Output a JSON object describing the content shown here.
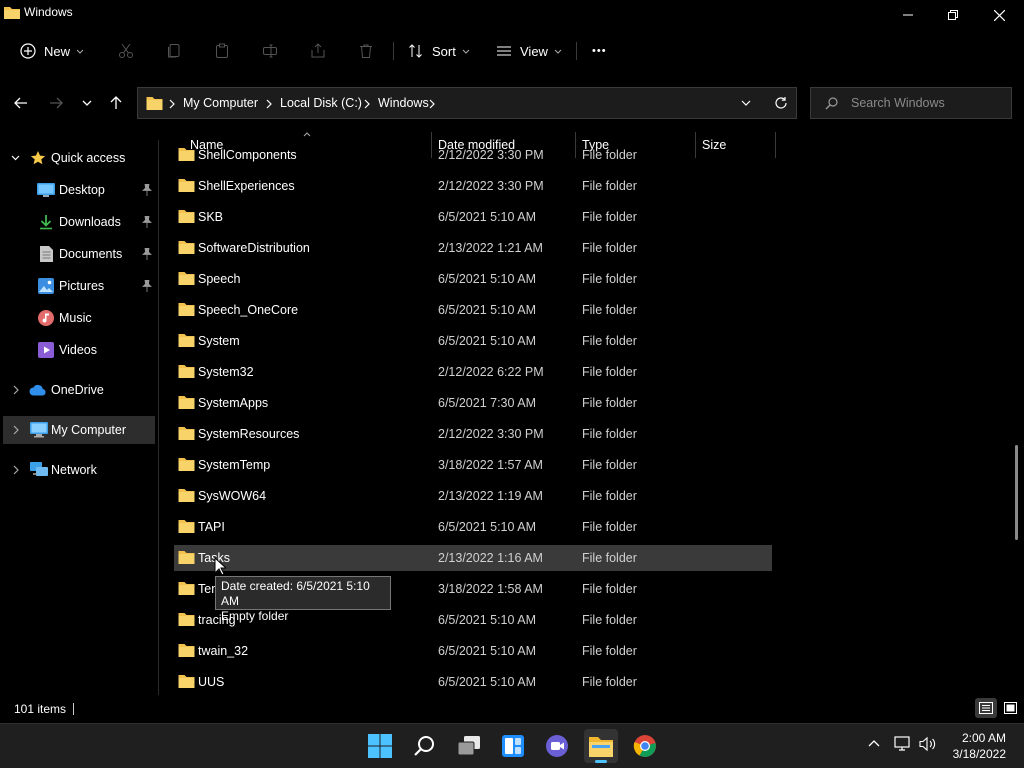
{
  "window": {
    "title": "Windows"
  },
  "toolbar": {
    "new_label": "New",
    "sort_label": "Sort",
    "view_label": "View",
    "more_label": "•••"
  },
  "address": {
    "segments": [
      "My Computer",
      "Local Disk (C:)",
      "Windows"
    ]
  },
  "search": {
    "placeholder": "Search Windows"
  },
  "sidebar": {
    "quick_access": "Quick access",
    "items": [
      {
        "label": "Desktop"
      },
      {
        "label": "Downloads"
      },
      {
        "label": "Documents"
      },
      {
        "label": "Pictures"
      },
      {
        "label": "Music"
      },
      {
        "label": "Videos"
      }
    ],
    "onedrive": "OneDrive",
    "my_computer": "My Computer",
    "network": "Network"
  },
  "columns": {
    "name": "Name",
    "date": "Date modified",
    "type": "Type",
    "size": "Size"
  },
  "rows": [
    {
      "name": "ShellComponents",
      "date": "2/12/2022 3:30 PM",
      "type": "File folder"
    },
    {
      "name": "ShellExperiences",
      "date": "2/12/2022 3:30 PM",
      "type": "File folder"
    },
    {
      "name": "SKB",
      "date": "6/5/2021 5:10 AM",
      "type": "File folder"
    },
    {
      "name": "SoftwareDistribution",
      "date": "2/13/2022 1:21 AM",
      "type": "File folder"
    },
    {
      "name": "Speech",
      "date": "6/5/2021 5:10 AM",
      "type": "File folder"
    },
    {
      "name": "Speech_OneCore",
      "date": "6/5/2021 5:10 AM",
      "type": "File folder"
    },
    {
      "name": "System",
      "date": "6/5/2021 5:10 AM",
      "type": "File folder"
    },
    {
      "name": "System32",
      "date": "2/12/2022 6:22 PM",
      "type": "File folder"
    },
    {
      "name": "SystemApps",
      "date": "6/5/2021 7:30 AM",
      "type": "File folder"
    },
    {
      "name": "SystemResources",
      "date": "2/12/2022 3:30 PM",
      "type": "File folder"
    },
    {
      "name": "SystemTemp",
      "date": "3/18/2022 1:57 AM",
      "type": "File folder"
    },
    {
      "name": "SysWOW64",
      "date": "2/13/2022 1:19 AM",
      "type": "File folder"
    },
    {
      "name": "TAPI",
      "date": "6/5/2021 5:10 AM",
      "type": "File folder"
    },
    {
      "name": "Tasks",
      "date": "2/13/2022 1:16 AM",
      "type": "File folder"
    },
    {
      "name": "Temp",
      "date": "3/18/2022 1:58 AM",
      "type": "File folder"
    },
    {
      "name": "tracing",
      "date": "6/5/2021 5:10 AM",
      "type": "File folder"
    },
    {
      "name": "twain_32",
      "date": "6/5/2021 5:10 AM",
      "type": "File folder"
    },
    {
      "name": "UUS",
      "date": "6/5/2021 5:10 AM",
      "type": "File folder"
    }
  ],
  "tooltip": {
    "line1": "Date created: 6/5/2021 5:10 AM",
    "line2": "Empty folder"
  },
  "status": {
    "item_count": "101 items"
  },
  "clock": {
    "time": "2:00 AM",
    "date": "3/18/2022"
  },
  "colors": {
    "folder": "#f2c14e",
    "accent": "#4cc2ff",
    "background": "#000000"
  }
}
